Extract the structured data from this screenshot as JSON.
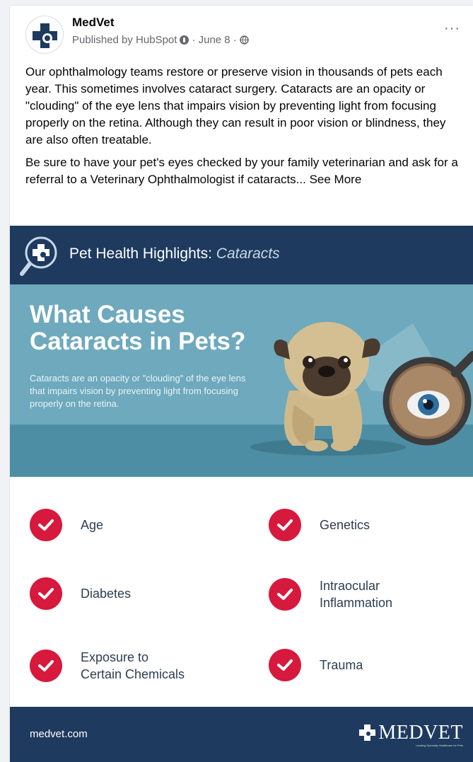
{
  "post": {
    "author": "MedVet",
    "published_by": "Published by HubSpot",
    "date": "· June 8 ·",
    "more_label": "···",
    "paragraph1": "Our ophthalmology teams restore or preserve vision in thousands of pets each year. This sometimes involves cataract surgery. Cataracts are an opacity or \"clouding\" of the eye lens that impairs vision by preventing light from focusing properly on the retina. Although they can result in poor vision or blindness, they are also often treatable.",
    "paragraph2": "Be sure to have your pet's eyes checked by your family veterinarian and ask for a referral to a Veterinary Ophthalmologist if cataracts...",
    "see_more": "See More"
  },
  "infographic": {
    "banner_title": "Pet Health Highlights: ",
    "banner_topic": "Cataracts",
    "heading": "What Causes Cataracts in Pets?",
    "body": "Cataracts are an opacity or \"clouding\" of the eye lens that impairs vision by preventing light from focusing properly on the retina.",
    "causes": [
      "Age",
      "Genetics",
      "Diabetes",
      "Intraocular\nInflammation",
      "Exposure to\nCertain Chemicals",
      "Trauma"
    ],
    "footer_url": "medvet.com",
    "footer_brand": "MEDVET",
    "footer_tagline": "Leading Specialty Healthcare for Pets"
  },
  "colors": {
    "navy": "#1e3a5f",
    "hero_blue": "#6ea9bd",
    "check_red": "#d6193c"
  },
  "icons": [
    "medvet-cross-logo",
    "info-icon",
    "globe-icon",
    "more-icon",
    "magnifier-icon",
    "check-icon",
    "pug-illustration",
    "eye-magnifier-illustration"
  ]
}
